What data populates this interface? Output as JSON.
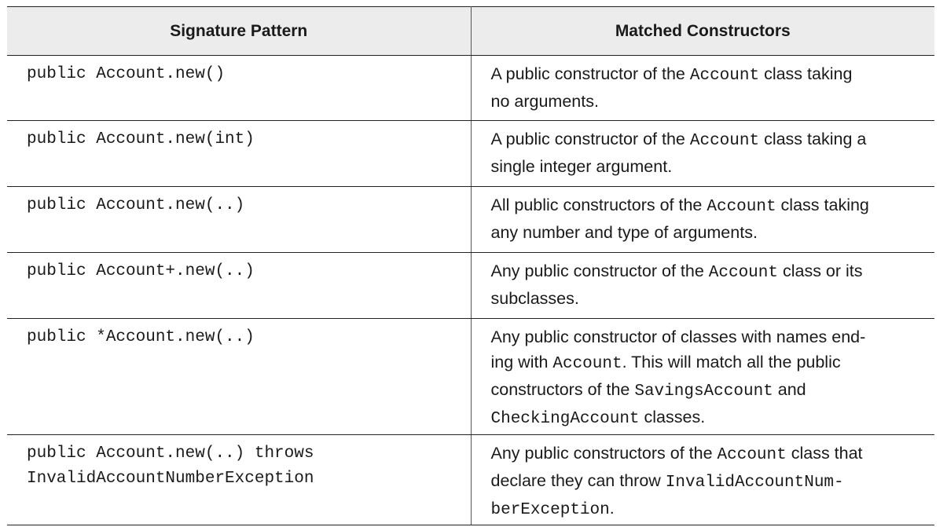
{
  "table": {
    "headers": [
      "Signature Pattern",
      "Matched Constructors"
    ],
    "rows": [
      {
        "signature": [
          "public Account.new()"
        ],
        "description": [
          [
            {
              "t": "A public constructor of the "
            },
            {
              "c": "Account"
            },
            {
              "t": " class taking"
            }
          ],
          [
            {
              "t": "no arguments."
            }
          ]
        ]
      },
      {
        "signature": [
          "public Account.new(int)"
        ],
        "description": [
          [
            {
              "t": "A public constructor of the "
            },
            {
              "c": "Account"
            },
            {
              "t": " class taking a"
            }
          ],
          [
            {
              "t": "single integer argument."
            }
          ]
        ]
      },
      {
        "signature": [
          "public Account.new(..)"
        ],
        "description": [
          [
            {
              "t": "All public constructors of the "
            },
            {
              "c": "Account"
            },
            {
              "t": " class taking"
            }
          ],
          [
            {
              "t": "any number and type of arguments."
            }
          ]
        ]
      },
      {
        "signature": [
          "public Account+.new(..)"
        ],
        "description": [
          [
            {
              "t": "Any public constructor of the "
            },
            {
              "c": "Account"
            },
            {
              "t": " class or its"
            }
          ],
          [
            {
              "t": "subclasses."
            }
          ]
        ]
      },
      {
        "signature": [
          "public *Account.new(..)"
        ],
        "description": [
          [
            {
              "t": "Any public constructor of classes with names end-"
            }
          ],
          [
            {
              "t": "ing with "
            },
            {
              "c": "Account"
            },
            {
              "t": ". This will match all the public"
            }
          ],
          [
            {
              "t": "constructors of the "
            },
            {
              "c": "SavingsAccount"
            },
            {
              "t": " and"
            }
          ],
          [
            {
              "c": "CheckingAccount"
            },
            {
              "t": " classes."
            }
          ]
        ]
      },
      {
        "signature": [
          "public Account.new(..) throws",
          "InvalidAccountNumberException"
        ],
        "description": [
          [
            {
              "t": "Any public constructors of the "
            },
            {
              "c": "Account"
            },
            {
              "t": " class that"
            }
          ],
          [
            {
              "t": "declare they can throw "
            },
            {
              "c": "InvalidAccountNum-"
            }
          ],
          [
            {
              "c": "berException"
            },
            {
              "t": "."
            }
          ]
        ]
      }
    ]
  }
}
